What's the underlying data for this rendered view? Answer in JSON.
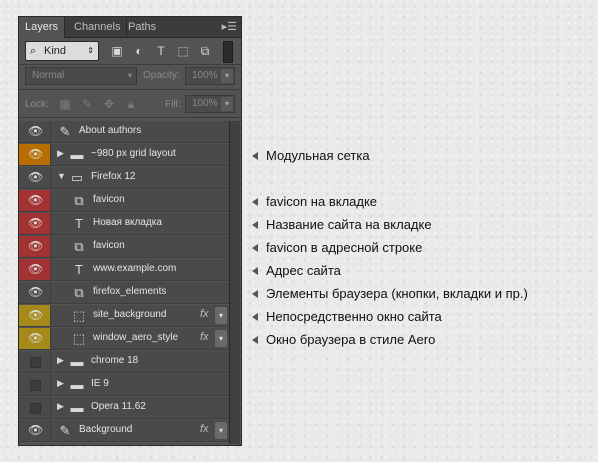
{
  "tabs": {
    "layers": "Layers",
    "channels": "Channels",
    "paths": "Paths",
    "menu_icon": "panel-menu-icon"
  },
  "filter": {
    "kind": "Kind"
  },
  "blend": {
    "mode": "Normal",
    "opacity_label": "Opacity:",
    "opacity_value": "100%"
  },
  "lock": {
    "label": "Lock:",
    "fill_label": "Fill:",
    "fill_value": "100%"
  },
  "layers": [
    {
      "name": "About authors",
      "type": "brush",
      "eye": "visible",
      "color": "#4a4a4a",
      "indent": 0
    },
    {
      "name": "~980 px grid layout",
      "type": "folder",
      "eye": "visible",
      "color": "#b86e00",
      "indent": 0,
      "disclosure": "closed"
    },
    {
      "name": "Firefox 12",
      "type": "folder-open",
      "eye": "visible",
      "color": "#4a4a4a",
      "indent": 0,
      "disclosure": "open"
    },
    {
      "name": "favicon",
      "type": "smart",
      "eye": "visible",
      "color": "#a33333",
      "indent": 1
    },
    {
      "name": "Новая вкладка",
      "type": "text",
      "eye": "visible",
      "color": "#a33333",
      "indent": 1
    },
    {
      "name": "favicon",
      "type": "smart",
      "eye": "visible",
      "color": "#a33333",
      "indent": 1
    },
    {
      "name": "www.example.com",
      "type": "text",
      "eye": "visible",
      "color": "#a33333",
      "indent": 1
    },
    {
      "name": "firefox_elements",
      "type": "smart",
      "eye": "visible",
      "color": "#4a4a4a",
      "indent": 1
    },
    {
      "name": "site_background",
      "type": "shape",
      "eye": "visible",
      "color": "#a58a1a",
      "indent": 1,
      "fx": true
    },
    {
      "name": "window_aero_style",
      "type": "shape",
      "eye": "visible",
      "color": "#a58a1a",
      "indent": 1,
      "fx": true
    },
    {
      "name": "chrome 18",
      "type": "folder",
      "eye": "hidden",
      "color": "#4a4a4a",
      "indent": 0,
      "disclosure": "closed"
    },
    {
      "name": "IE 9",
      "type": "folder",
      "eye": "hidden",
      "color": "#4a4a4a",
      "indent": 0,
      "disclosure": "closed"
    },
    {
      "name": "Opera 11.62",
      "type": "folder",
      "eye": "hidden",
      "color": "#4a4a4a",
      "indent": 0,
      "disclosure": "closed"
    },
    {
      "name": "Background",
      "type": "brush",
      "eye": "visible",
      "color": "#4a4a4a",
      "indent": 0,
      "fx": true
    }
  ],
  "annotations": {
    "grid": "Модульная сетка",
    "favicon_tab": "favicon на вкладке",
    "tab_title": "Название сайта на вкладке",
    "favicon_address": "favicon в адресной строке",
    "site_address": "Адрес сайта",
    "browser_elements": "Элементы браузера (кнопки, вкладки и пр.)",
    "site_window": "Непосредственно окно сайта",
    "aero_window": "Окно браузера в стиле Aero"
  },
  "fx_label": "fx"
}
